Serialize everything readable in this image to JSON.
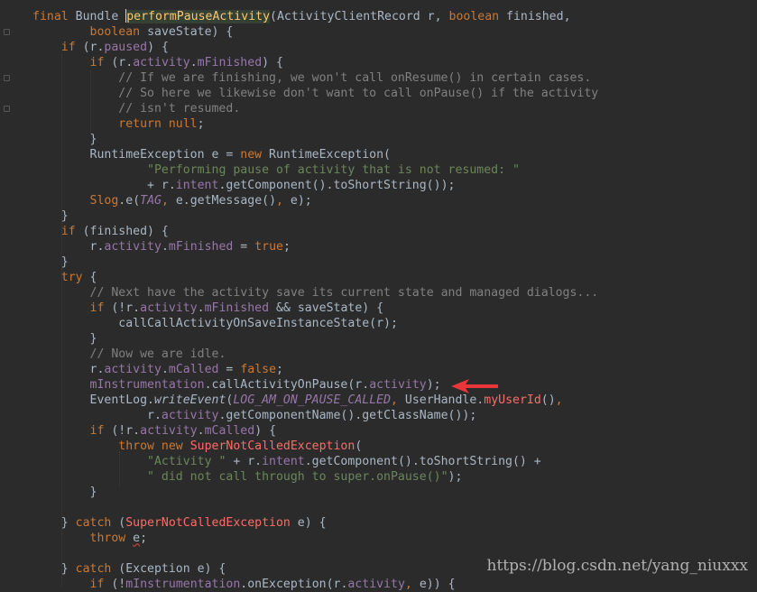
{
  "editor": {
    "lines": [
      [
        [
          "kw",
          "final "
        ],
        [
          "plain",
          "Bundle "
        ],
        [
          "cursor",
          ""
        ],
        [
          "hlmethod",
          "performPauseActivity"
        ],
        [
          "plain",
          "(ActivityClientRecord r, "
        ],
        [
          "kw",
          "boolean "
        ],
        [
          "plain",
          "finished,"
        ]
      ],
      [
        [
          "plain",
          "        "
        ],
        [
          "kw",
          "boolean "
        ],
        [
          "plain",
          "saveState) {"
        ]
      ],
      [
        [
          "plain",
          "    "
        ],
        [
          "kw",
          "if "
        ],
        [
          "plain",
          "(r."
        ],
        [
          "field",
          "paused"
        ],
        [
          "plain",
          ") {"
        ]
      ],
      [
        [
          "plain",
          "        "
        ],
        [
          "kw",
          "if "
        ],
        [
          "plain",
          "(r."
        ],
        [
          "field",
          "activity"
        ],
        [
          "plain",
          "."
        ],
        [
          "field",
          "mFinished"
        ],
        [
          "plain",
          ") {"
        ]
      ],
      [
        [
          "plain",
          "            "
        ],
        [
          "com",
          "// If we are finishing, we won't call onResume() in certain cases."
        ]
      ],
      [
        [
          "plain",
          "            "
        ],
        [
          "com",
          "// So here we likewise don't want to call onPause() if the activity"
        ]
      ],
      [
        [
          "plain",
          "            "
        ],
        [
          "com",
          "// isn't resumed."
        ]
      ],
      [
        [
          "plain",
          "            "
        ],
        [
          "kw",
          "return null"
        ],
        [
          "plain",
          ";"
        ]
      ],
      [
        [
          "plain",
          "        }"
        ]
      ],
      [
        [
          "plain",
          "        RuntimeException e = "
        ],
        [
          "kw",
          "new "
        ],
        [
          "plain",
          "RuntimeException("
        ]
      ],
      [
        [
          "plain",
          "                "
        ],
        [
          "str",
          "\"Performing pause of activity that is not resumed: \""
        ]
      ],
      [
        [
          "plain",
          "                + r."
        ],
        [
          "field",
          "intent"
        ],
        [
          "plain",
          ".getComponent().toShortString());"
        ]
      ],
      [
        [
          "plain",
          "        "
        ],
        [
          "log",
          "Slog"
        ],
        [
          "plain",
          "."
        ],
        [
          "plain",
          "e("
        ],
        [
          "static",
          "TAG"
        ],
        [
          "kw",
          ", "
        ],
        [
          "plain",
          "e.getMessage()"
        ],
        [
          "kw",
          ", "
        ],
        [
          "plain",
          "e);"
        ]
      ],
      [
        [
          "plain",
          "    }"
        ]
      ],
      [
        [
          "plain",
          "    "
        ],
        [
          "kw",
          "if "
        ],
        [
          "plain",
          "(finished) {"
        ]
      ],
      [
        [
          "plain",
          "        r."
        ],
        [
          "field",
          "activity"
        ],
        [
          "plain",
          "."
        ],
        [
          "field",
          "mFinished "
        ],
        [
          "plain",
          "= "
        ],
        [
          "kw",
          "true"
        ],
        [
          "plain",
          ";"
        ]
      ],
      [
        [
          "plain",
          "    }"
        ]
      ],
      [
        [
          "plain",
          "    "
        ],
        [
          "kw",
          "try "
        ],
        [
          "plain",
          "{"
        ]
      ],
      [
        [
          "plain",
          "        "
        ],
        [
          "com",
          "// Next have the activity save its current state and managed dialogs..."
        ]
      ],
      [
        [
          "plain",
          "        "
        ],
        [
          "kw",
          "if "
        ],
        [
          "plain",
          "(!r."
        ],
        [
          "field",
          "activity"
        ],
        [
          "plain",
          "."
        ],
        [
          "field",
          "mFinished "
        ],
        [
          "plain",
          "&& saveState) {"
        ]
      ],
      [
        [
          "plain",
          "            callCallActivityOnSaveInstanceState(r);"
        ]
      ],
      [
        [
          "plain",
          "        }"
        ]
      ],
      [
        [
          "plain",
          "        "
        ],
        [
          "com",
          "// Now we are idle."
        ]
      ],
      [
        [
          "plain",
          "        r."
        ],
        [
          "field",
          "activity"
        ],
        [
          "plain",
          "."
        ],
        [
          "field",
          "mCalled "
        ],
        [
          "plain",
          "= "
        ],
        [
          "kw",
          "false"
        ],
        [
          "plain",
          ";"
        ]
      ],
      [
        [
          "plain",
          "        "
        ],
        [
          "field",
          "mInstrumentation"
        ],
        [
          "plain",
          ".callActivityOnPause(r."
        ],
        [
          "field",
          "activity"
        ],
        [
          "plain",
          ");"
        ]
      ],
      [
        [
          "plain",
          "        EventLog."
        ],
        [
          "italic",
          "writeEvent"
        ],
        [
          "plain",
          "("
        ],
        [
          "static",
          "LOG_AM_ON_PAUSE_CALLED"
        ],
        [
          "kw",
          ", "
        ],
        [
          "plain",
          "UserHandle."
        ],
        [
          "excl",
          "myUserId"
        ],
        [
          "plain",
          "()"
        ],
        [
          "kw",
          ","
        ]
      ],
      [
        [
          "plain",
          "                r."
        ],
        [
          "field",
          "activity"
        ],
        [
          "plain",
          ".getComponentName().getClassName());"
        ]
      ],
      [
        [
          "plain",
          "        "
        ],
        [
          "kw",
          "if "
        ],
        [
          "plain",
          "(!r."
        ],
        [
          "field",
          "activity"
        ],
        [
          "plain",
          "."
        ],
        [
          "field",
          "mCalled"
        ],
        [
          "plain",
          ") {"
        ]
      ],
      [
        [
          "plain",
          "            "
        ],
        [
          "kw",
          "throw new "
        ],
        [
          "excl",
          "SuperNotCalledException"
        ],
        [
          "plain",
          "("
        ]
      ],
      [
        [
          "plain",
          "                "
        ],
        [
          "str",
          "\"Activity \" "
        ],
        [
          "plain",
          "+ r."
        ],
        [
          "field",
          "intent"
        ],
        [
          "plain",
          ".getComponent().toShortString() +"
        ]
      ],
      [
        [
          "plain",
          "                "
        ],
        [
          "str",
          "\" did not call through to super.onPause()\""
        ],
        [
          "plain",
          ");"
        ]
      ],
      [
        [
          "plain",
          "        }"
        ]
      ],
      [
        [
          "plain",
          ""
        ]
      ],
      [
        [
          "plain",
          "    } "
        ],
        [
          "kw",
          "catch "
        ],
        [
          "plain",
          "("
        ],
        [
          "excl",
          "SuperNotCalledException "
        ],
        [
          "plain",
          "e) {"
        ]
      ],
      [
        [
          "plain",
          "        "
        ],
        [
          "kw",
          "throw "
        ],
        [
          "err",
          "e"
        ],
        [
          "plain",
          ";"
        ]
      ],
      [
        [
          "plain",
          ""
        ]
      ],
      [
        [
          "plain",
          "    } "
        ],
        [
          "kw",
          "catch "
        ],
        [
          "plain",
          "(Exception e) {"
        ]
      ],
      [
        [
          "plain",
          "        "
        ],
        [
          "kw",
          "if "
        ],
        [
          "plain",
          "(!"
        ],
        [
          "field",
          "mInstrumentation"
        ],
        [
          "plain",
          ".onException(r."
        ],
        [
          "field",
          "activity"
        ],
        [
          "kw",
          ", "
        ],
        [
          "plain",
          "e)) {"
        ]
      ]
    ]
  },
  "watermark": "https://blog.csdn.net/yang_niuxxx",
  "colors": {
    "background": "#2b2b2b",
    "keyword": "#cc7832",
    "field": "#9876aa",
    "string": "#6a8759",
    "comment": "#808080",
    "plain": "#a9b7c6",
    "arrow": "#e8363a"
  }
}
